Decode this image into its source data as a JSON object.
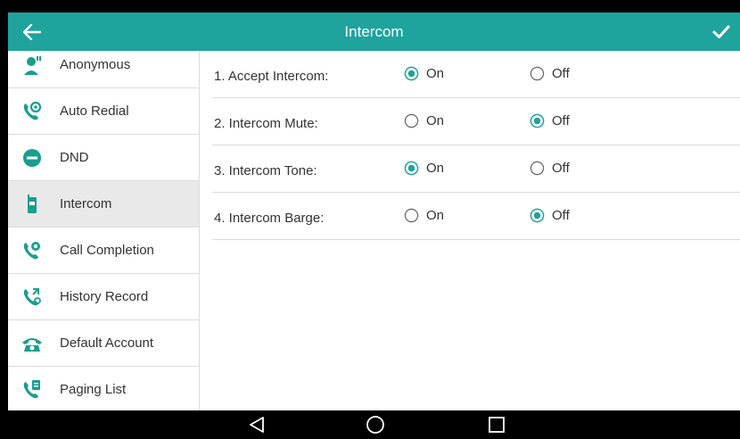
{
  "header": {
    "title": "Intercom",
    "back_icon": "arrow-left-icon",
    "confirm_icon": "checkmark-icon",
    "color": "#1fa39d"
  },
  "sidebar": {
    "items": [
      {
        "label": "Anonymous",
        "icon": "anonymous-icon",
        "active": false
      },
      {
        "label": "Auto Redial",
        "icon": "auto-redial-icon",
        "active": false
      },
      {
        "label": "DND",
        "icon": "dnd-icon",
        "active": false
      },
      {
        "label": "Intercom",
        "icon": "intercom-icon",
        "active": true
      },
      {
        "label": "Call Completion",
        "icon": "call-completion-icon",
        "active": false
      },
      {
        "label": "History Record",
        "icon": "history-record-icon",
        "active": false
      },
      {
        "label": "Default Account",
        "icon": "default-account-icon",
        "active": false
      },
      {
        "label": "Paging List",
        "icon": "paging-list-icon",
        "active": false
      }
    ]
  },
  "settings": [
    {
      "label": "1. Accept Intercom:",
      "on_label": "On",
      "off_label": "Off",
      "value": "On"
    },
    {
      "label": "2. Intercom Mute:",
      "on_label": "On",
      "off_label": "Off",
      "value": "Off"
    },
    {
      "label": "3. Intercom Tone:",
      "on_label": "On",
      "off_label": "Off",
      "value": "On"
    },
    {
      "label": "4. Intercom Barge:",
      "on_label": "On",
      "off_label": "Off",
      "value": "Off"
    }
  ],
  "navbar": {
    "back_icon": "triangle-back-icon",
    "home_icon": "circle-home-icon",
    "recents_icon": "square-recents-icon"
  },
  "colors": {
    "accent": "#1fa39d",
    "icon_green": "#1a9e8f"
  }
}
